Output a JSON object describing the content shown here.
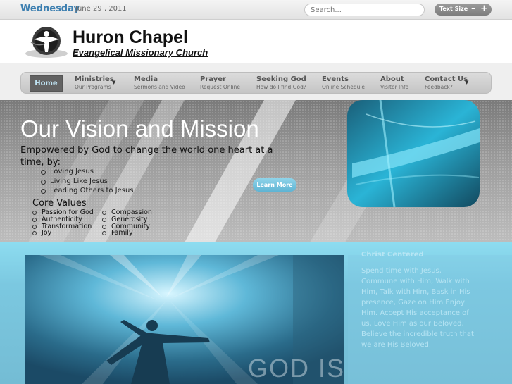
{
  "topbar": {
    "day": "Wednesday",
    "date": "June 29 , 2011",
    "search_placeholder": "Search...",
    "text_size_label": "Text Size",
    "minus": "–",
    "plus": "+"
  },
  "header": {
    "title": "Huron Chapel",
    "subtitle": "Evangelical Missionary Church"
  },
  "nav": {
    "home": "Home",
    "items": [
      {
        "label": "Ministries",
        "sub": "Our Programs"
      },
      {
        "label": "Media",
        "sub": "Sermons and Video"
      },
      {
        "label": "Prayer",
        "sub": "Request Online"
      },
      {
        "label": "Seeking God",
        "sub": "How do I find God?"
      },
      {
        "label": "Events",
        "sub": "Online Schedule"
      },
      {
        "label": "About",
        "sub": "Visitor Info"
      },
      {
        "label": "Contact Us",
        "sub": "Feedback?"
      }
    ],
    "caret": "▼"
  },
  "hero": {
    "title": "Our Vision and Mission",
    "lead": "Empowered by God to change the world one heart at a time, by:",
    "bullets": [
      "Loving Jesus",
      "Living Like Jesus",
      "Leading Others to Jesus"
    ],
    "core_values_title": "Core Values",
    "core_values_col1": [
      "Passion for God",
      "Authenticity",
      "Transformation",
      "Joy"
    ],
    "core_values_col2": [
      "Compassion",
      "Generosity",
      "Community",
      "Family"
    ],
    "learn_more": "Learn More"
  },
  "feature": {
    "image_text": "GOD IS",
    "side_title": "Christ Centered",
    "side_text": "Spend time with Jesus, Commune with Him, Walk with Him, Talk with Him, Bask in His presence, Gaze on Him Enjoy Him. Accept His acceptance of us, Love Him as our Beloved, Believe the incredible truth that we are His Beloved."
  },
  "colors": {
    "accent_blue": "#3d7fb0",
    "hero_teal": "#2ab4d6",
    "lower_blue": "#8ddcf0"
  }
}
